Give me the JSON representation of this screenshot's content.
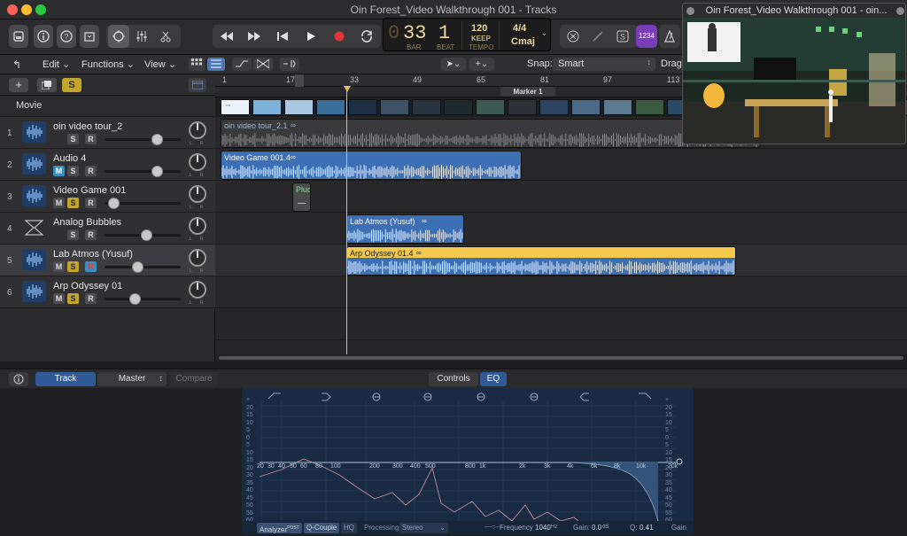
{
  "window": {
    "title": "Oin Forest_Video Walkthrough 001 - Tracks"
  },
  "lcd": {
    "bar_prefix": "0",
    "bar": "33",
    "beat": "1",
    "bar_label": "BAR",
    "beat_label": "BEAT",
    "tempo": "120",
    "keep": "KEEP",
    "tempo_label": "TEMPO",
    "signature": "4/4",
    "key": "Cmaj"
  },
  "toolbar": {
    "count_in": "1234"
  },
  "menubar": {
    "edit": "Edit",
    "functions": "Functions",
    "view": "View",
    "snap_label": "Snap:",
    "snap_value": "Smart",
    "drag_label": "Drag:"
  },
  "header": {
    "movie_label": "Movie",
    "s_label": "S"
  },
  "ruler": {
    "ticks": [
      "1",
      "17",
      "33",
      "49",
      "65",
      "81",
      "97",
      "113"
    ],
    "marker": "Marker 1"
  },
  "movie_thumbs_label": "▫▫",
  "tracks": [
    {
      "num": "1",
      "name": "oin video tour_2",
      "m": false,
      "s": false,
      "r": false,
      "vol": 0.73,
      "show_m": false
    },
    {
      "num": "2",
      "name": "Audio 4",
      "m": true,
      "s": false,
      "r": false,
      "vol": 0.73,
      "show_m": true
    },
    {
      "num": "3",
      "name": "Video Game 001",
      "m": false,
      "s": true,
      "r": false,
      "vol": 0.05,
      "show_m": true
    },
    {
      "num": "4",
      "name": "Analog Bubbles",
      "m": false,
      "s": false,
      "r": false,
      "vol": 0.56,
      "show_m": false
    },
    {
      "num": "5",
      "name": "Lab Atmos (Yusuf)",
      "m": false,
      "s": true,
      "r": true,
      "vol": 0.42,
      "show_m": true
    },
    {
      "num": "6",
      "name": "Arp Odyssey 01",
      "m": false,
      "s": true,
      "r": false,
      "vol": 0.38,
      "show_m": true
    }
  ],
  "track_btn": {
    "m": "M",
    "s": "S",
    "r": "R",
    "pan_l": "L",
    "pan_r": "R"
  },
  "regions": [
    {
      "name": "oin video tour_2.1"
    },
    {
      "name": "Video Game 001.4"
    },
    {
      "name": "Pluc"
    },
    {
      "name": "Lab Atmos (Yusuf)"
    },
    {
      "name": "Arp Odyssey 01.4"
    }
  ],
  "preview": {
    "title": "Oin Forest_Video Walkthrough 001 - oin..."
  },
  "bottom": {
    "track": "Track",
    "master": "Master",
    "compare": "Compare",
    "controls": "Controls",
    "eq": "EQ"
  },
  "eq": {
    "freq_labels": [
      "20",
      "30",
      "40",
      "50",
      "60",
      "80",
      "100",
      "200",
      "300",
      "400",
      "500",
      "800",
      "1k",
      "2k",
      "3k",
      "4k",
      "6k",
      "8k",
      "10k",
      "20k"
    ],
    "db_left": [
      "+",
      "20",
      "15",
      "10",
      "5",
      "0",
      "5",
      "10",
      "15",
      "20",
      "30",
      "35",
      "40",
      "45",
      "50",
      "55",
      "60"
    ],
    "analyzer": "Analyzer",
    "analyzer_sup": "POST",
    "qcouple": "Q-Couple",
    "hq": "HQ",
    "processing_label": "Processing",
    "processing_value": "Stereo",
    "freq_label": "Frequency",
    "freq_value": "1040",
    "freq_unit": "Hz",
    "gain_label": "Gain:",
    "gain_value": "0.0",
    "gain_unit": "dB",
    "q_label": "Q:",
    "q_value": "0.41",
    "gain_knob": "Gain"
  }
}
